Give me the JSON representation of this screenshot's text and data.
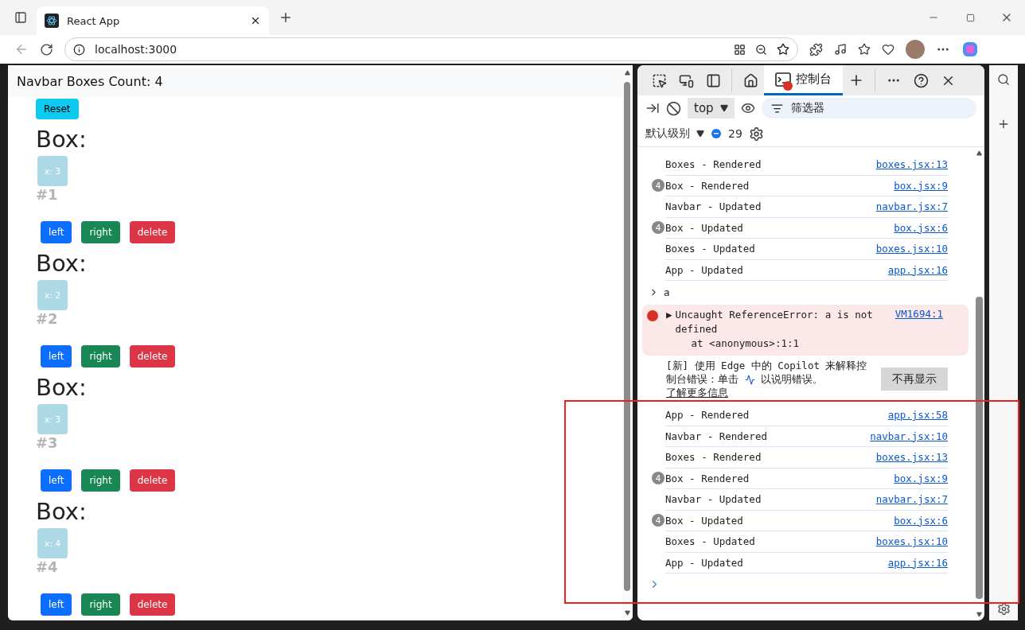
{
  "browser": {
    "tabs": [
      {
        "title": "React App",
        "selected": true
      }
    ],
    "address": "localhost:3000"
  },
  "page": {
    "navbar": {
      "title": "Navbar Boxes Count: 4"
    },
    "reset_button": "Reset",
    "boxes": [
      {
        "heading": "Box:",
        "value": "x: 3",
        "number": "#1",
        "buttons": [
          {
            "label": "left",
            "kind": "primary"
          },
          {
            "label": "right",
            "kind": "success"
          },
          {
            "label": "delete",
            "kind": "danger"
          }
        ]
      },
      {
        "heading": "Box:",
        "value": "x: 2",
        "number": "#2",
        "buttons": [
          {
            "label": "left",
            "kind": "primary"
          },
          {
            "label": "right",
            "kind": "success"
          },
          {
            "label": "delete",
            "kind": "danger"
          }
        ]
      },
      {
        "heading": "Box:",
        "value": "x: 3",
        "number": "#3",
        "buttons": [
          {
            "label": "left",
            "kind": "primary"
          },
          {
            "label": "right",
            "kind": "success"
          },
          {
            "label": "delete",
            "kind": "danger"
          }
        ]
      },
      {
        "heading": "Box:",
        "value": "x: 4",
        "number": "#4",
        "buttons": [
          {
            "label": "left",
            "kind": "primary"
          },
          {
            "label": "right",
            "kind": "success"
          },
          {
            "label": "delete",
            "kind": "danger"
          }
        ]
      }
    ]
  },
  "devtools": {
    "tabs": [
      {
        "label": "控制台",
        "selected": true,
        "has_error": true
      }
    ],
    "context": "top",
    "filter": {
      "placeholder": "筛选器"
    },
    "level": "默认级别",
    "message_count": "29",
    "entries": [
      {
        "kind": "log",
        "text": "Boxes - Rendered",
        "source": "boxes.jsx:13"
      },
      {
        "kind": "log",
        "count": "4",
        "text": "Box - Rendered",
        "source": "box.jsx:9"
      },
      {
        "kind": "log",
        "text": "Navbar - Updated",
        "source": "navbar.jsx:7"
      },
      {
        "kind": "log",
        "count": "4",
        "text": "Box - Updated",
        "source": "box.jsx:6"
      },
      {
        "kind": "log",
        "text": "Boxes - Updated",
        "source": "boxes.jsx:10"
      },
      {
        "kind": "log",
        "text": "App - Updated",
        "source": "app.jsx:16"
      },
      {
        "kind": "input",
        "text": "a"
      },
      {
        "kind": "error",
        "marker": "▶",
        "text": "Uncaught ReferenceError: a is not defined",
        "stack": "at <anonymous>:1:1",
        "source": "VM1694:1"
      },
      {
        "kind": "notice",
        "text": "[新] 使用 Edge 中的 Copilot 来解释控制台错误：单击",
        "after_icon": "以说明错误。",
        "link": "了解更多信息",
        "button": "不再显示"
      },
      {
        "kind": "log",
        "text": "App - Rendered",
        "source": "app.jsx:58"
      },
      {
        "kind": "log",
        "text": "Navbar - Rendered",
        "source": "navbar.jsx:10"
      },
      {
        "kind": "log",
        "text": "Boxes - Rendered",
        "source": "boxes.jsx:13"
      },
      {
        "kind": "log",
        "count": "4",
        "text": "Box - Rendered",
        "source": "box.jsx:9"
      },
      {
        "kind": "log",
        "text": "Navbar - Updated",
        "source": "navbar.jsx:7"
      },
      {
        "kind": "log",
        "count": "4",
        "text": "Box - Updated",
        "source": "box.jsx:6"
      },
      {
        "kind": "log",
        "text": "Boxes - Updated",
        "source": "boxes.jsx:10"
      },
      {
        "kind": "log",
        "text": "App - Updated",
        "source": "app.jsx:16"
      }
    ]
  },
  "annotations": [
    {
      "kind": "rectangle"
    }
  ]
}
